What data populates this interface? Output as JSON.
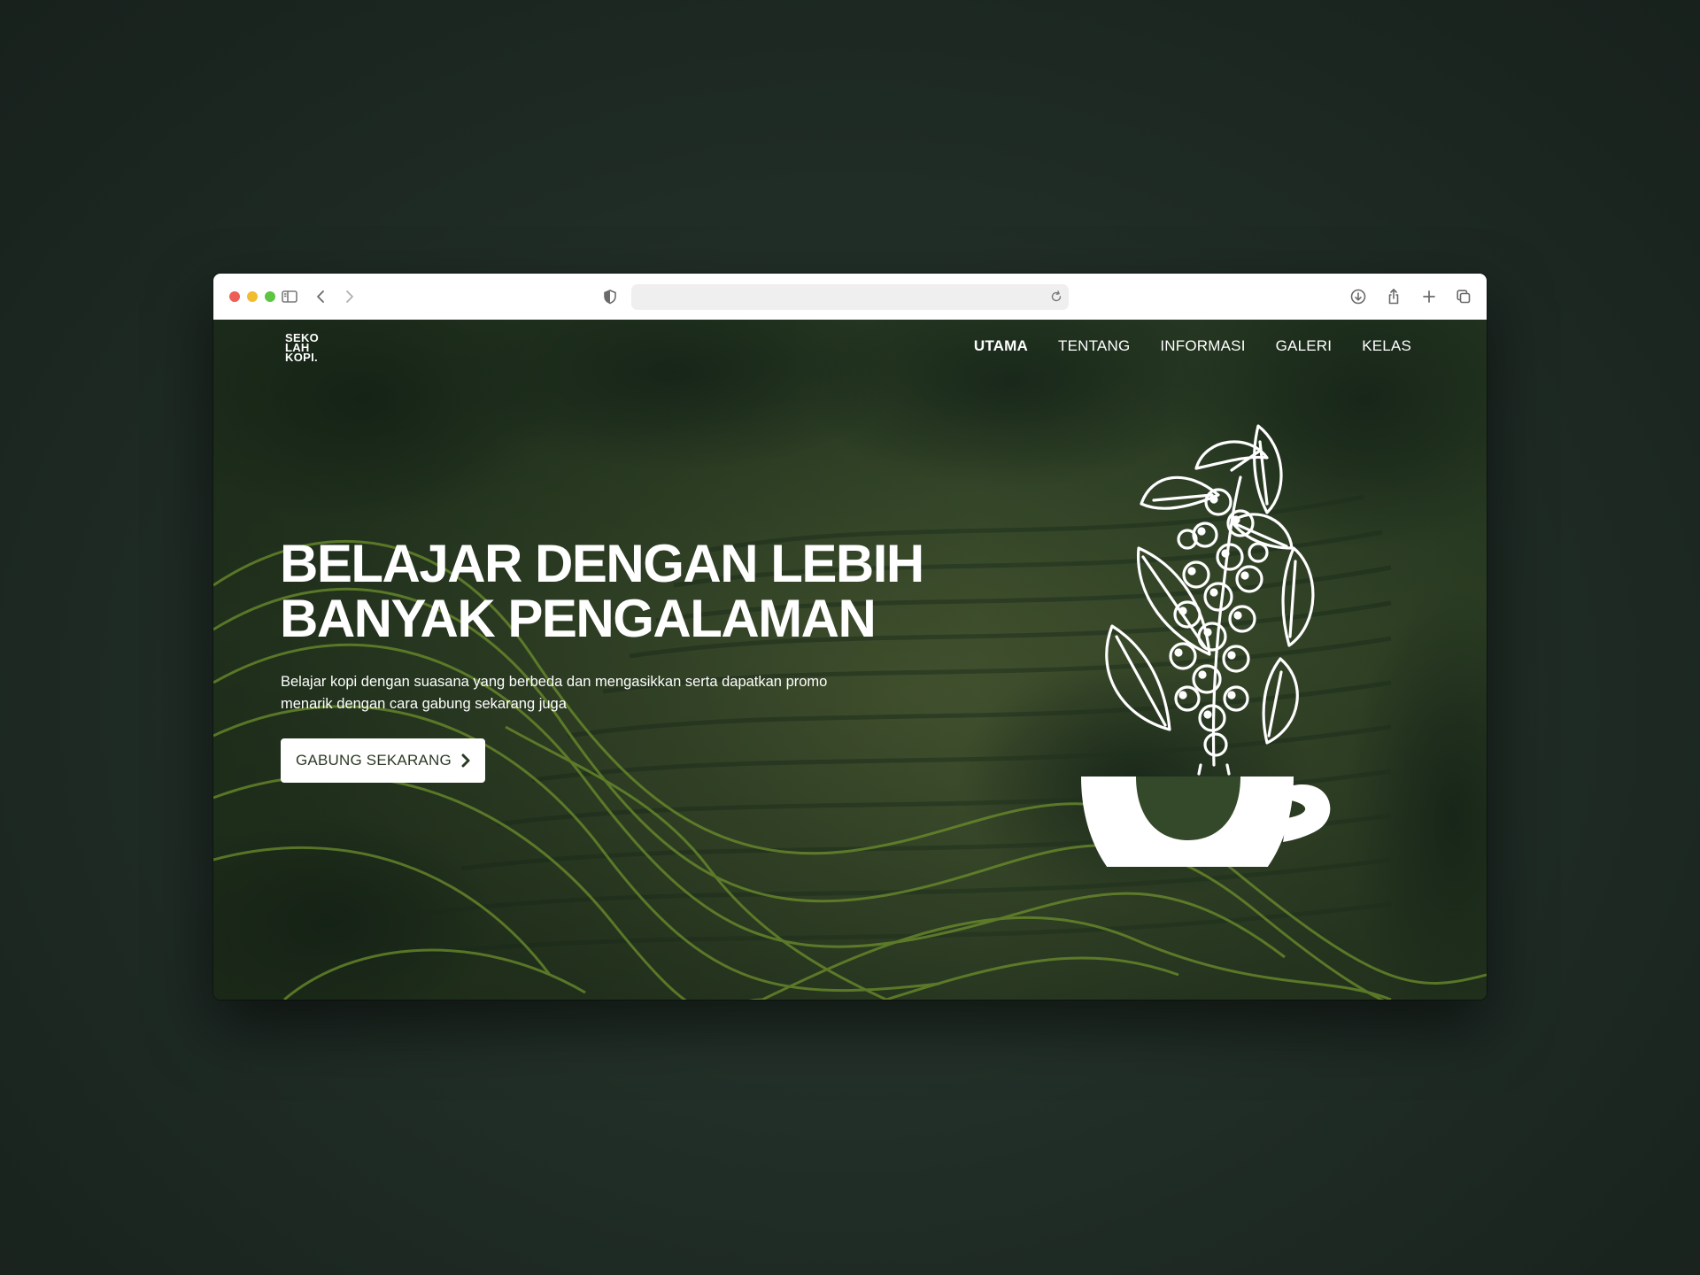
{
  "browser": {
    "traffic_lights": [
      "close",
      "minimize",
      "zoom"
    ],
    "toolbar_icons": {
      "sidebar": "sidebar-icon",
      "back": "chevron-left-icon",
      "forward": "chevron-right-icon",
      "privacy": "shield-icon",
      "reload": "reload-icon",
      "download": "download-icon",
      "share": "share-icon",
      "new_tab": "plus-icon",
      "tabs": "tab-overview-icon"
    },
    "address": ""
  },
  "site": {
    "logo_lines": [
      "SEKO",
      "LAH",
      "KOPI."
    ],
    "nav": [
      {
        "label": "UTAMA",
        "active": true
      },
      {
        "label": "TENTANG",
        "active": false
      },
      {
        "label": "INFORMASI",
        "active": false
      },
      {
        "label": "GALERI",
        "active": false
      },
      {
        "label": "KELAS",
        "active": false
      }
    ],
    "hero": {
      "title_lines": [
        "BELAJAR DENGAN LEBIH",
        "BANYAK PENGALAMAN"
      ],
      "subtitle": "Belajar kopi dengan suasana yang berbeda dan mengasikkan serta dapatkan promo menarik dengan cara gabung sekarang juga",
      "cta_label": "GABUNG SEKARANG",
      "cta_icon": "chevron-right-icon"
    },
    "illustration": "coffee-cherry-cup-icon"
  },
  "colors": {
    "background": "#1f2b25",
    "hero_overlay": "#1d2e1c",
    "contour_lines": "#6d8f2c",
    "text": "#ffffff",
    "cta_text": "#2d3b24"
  }
}
